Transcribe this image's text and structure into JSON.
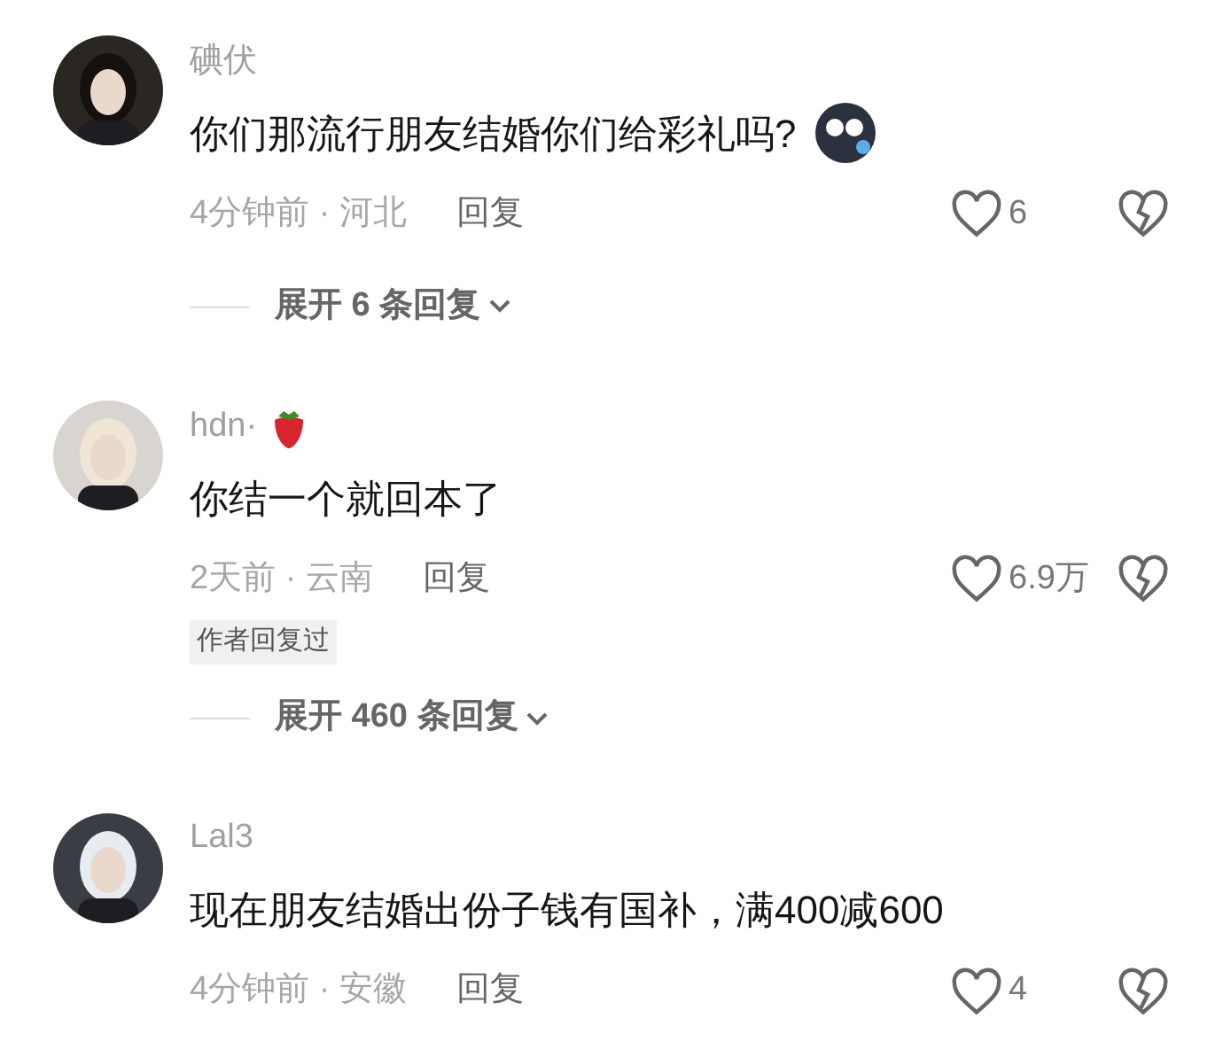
{
  "comments": [
    {
      "author": "碘伏",
      "author_emoji": false,
      "text": "你们那流行朋友结婚你们给彩礼吗?",
      "text_emoji": true,
      "meta": "4分钟前 · 河北",
      "reply": "回复",
      "likes": "6",
      "expand": "展开 6 条回复"
    },
    {
      "author": "hdn·",
      "author_emoji": true,
      "text": "你结一个就回本了",
      "text_emoji": false,
      "meta": "2天前 · 云南",
      "reply": "回复",
      "likes": "6.9万",
      "tag": "作者回复过",
      "expand": "展开 460 条回复"
    },
    {
      "author": "Lal3",
      "author_emoji": false,
      "text": "现在朋友结婚出份子钱有国补，满400减600",
      "text_emoji": false,
      "meta": "4分钟前 · 安徽",
      "reply": "回复",
      "likes": "4"
    }
  ]
}
